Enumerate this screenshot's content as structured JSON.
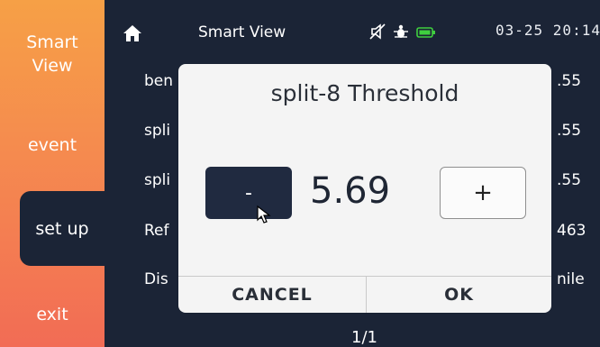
{
  "sidebar": {
    "items": [
      {
        "label": "Smart\nView"
      },
      {
        "label": "event"
      },
      {
        "label": "set up"
      },
      {
        "label": "exit"
      }
    ],
    "active": "set up"
  },
  "topbar": {
    "home_icon": "home-icon",
    "title": "Smart View",
    "mute_icon": "speaker-muted-icon",
    "bug_icon": "bug-icon",
    "battery_icon": "battery-icon",
    "clock": "03-25 20:14"
  },
  "list": {
    "rows": [
      {
        "label": "ben",
        "value": ".55"
      },
      {
        "label": "spli",
        "value": ".55"
      },
      {
        "label": "spli",
        "value": ".55"
      },
      {
        "label": "Ref",
        "value": "463"
      },
      {
        "label": "Dis",
        "value": "nile"
      }
    ],
    "pager": "1/1"
  },
  "dialog": {
    "title": "split-8 Threshold",
    "minus_label": "-",
    "value": "5.69",
    "plus_label": "+",
    "cancel_label": "CANCEL",
    "ok_label": "OK"
  },
  "colors": {
    "sidebar_top": "#f6a046",
    "sidebar_bottom": "#f26c55",
    "background": "#1b2436",
    "dialog_bg": "#f4f4f4",
    "minus_button": "#202a40",
    "battery": "#3fcf3f"
  }
}
